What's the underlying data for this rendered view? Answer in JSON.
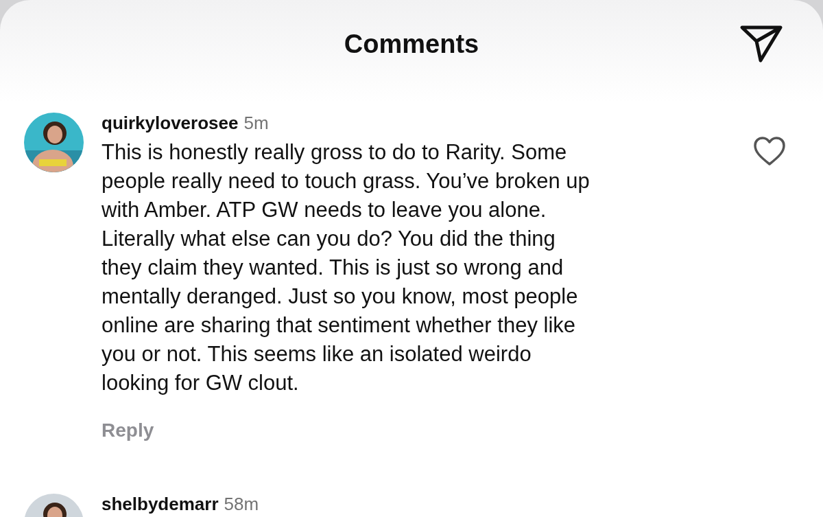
{
  "header": {
    "title": "Comments"
  },
  "comments": [
    {
      "username": "quirkyloverosee",
      "time": "5m",
      "text": "This is honestly really gross to do to Rarity. Some\npeople really need to touch grass. You’ve broken up\nwith Amber. ATP GW needs to leave you alone.\nLiterally what else can you do? You did the thing\nthey claim they wanted. This is just so wrong and\nmentally deranged. Just so you know, most people\nonline are sharing that sentiment whether they like\nyou or not. This seems like an isolated weirdo\nlooking for GW clout.",
      "reply": "Reply",
      "liked": false
    },
    {
      "username": "shelbydemarr",
      "time": "58m"
    }
  ]
}
